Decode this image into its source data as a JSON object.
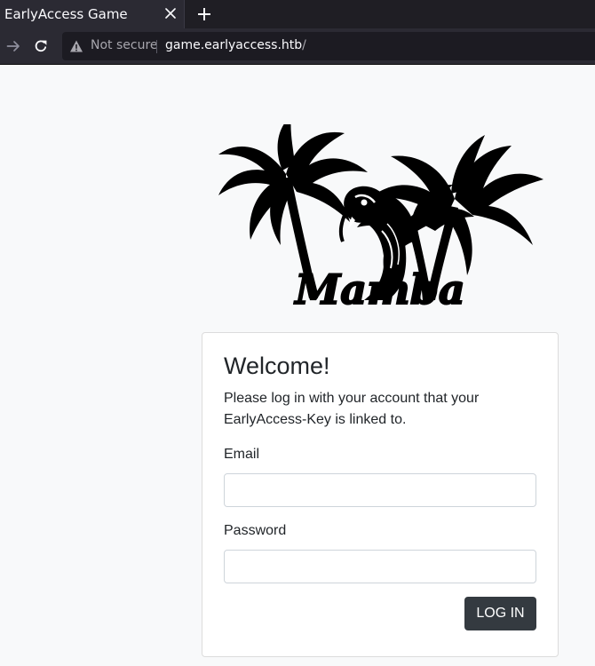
{
  "browser": {
    "tab_title": "EarlyAccess Game",
    "security_label": "Not secure",
    "url_host": "game.earlyaccess.htb",
    "url_path": "/"
  },
  "logo": {
    "text": "Mamba"
  },
  "login": {
    "heading": "Welcome!",
    "description": "Please log in with your account that your EarlyAccess-Key is linked to.",
    "email_label": "Email",
    "email_value": "",
    "password_label": "Password",
    "password_value": "",
    "submit_label": "LOG IN"
  },
  "colors": {
    "page_background": "#f8f9fa",
    "button_background": "#343a40",
    "browser_chrome": "#2b2a33"
  }
}
